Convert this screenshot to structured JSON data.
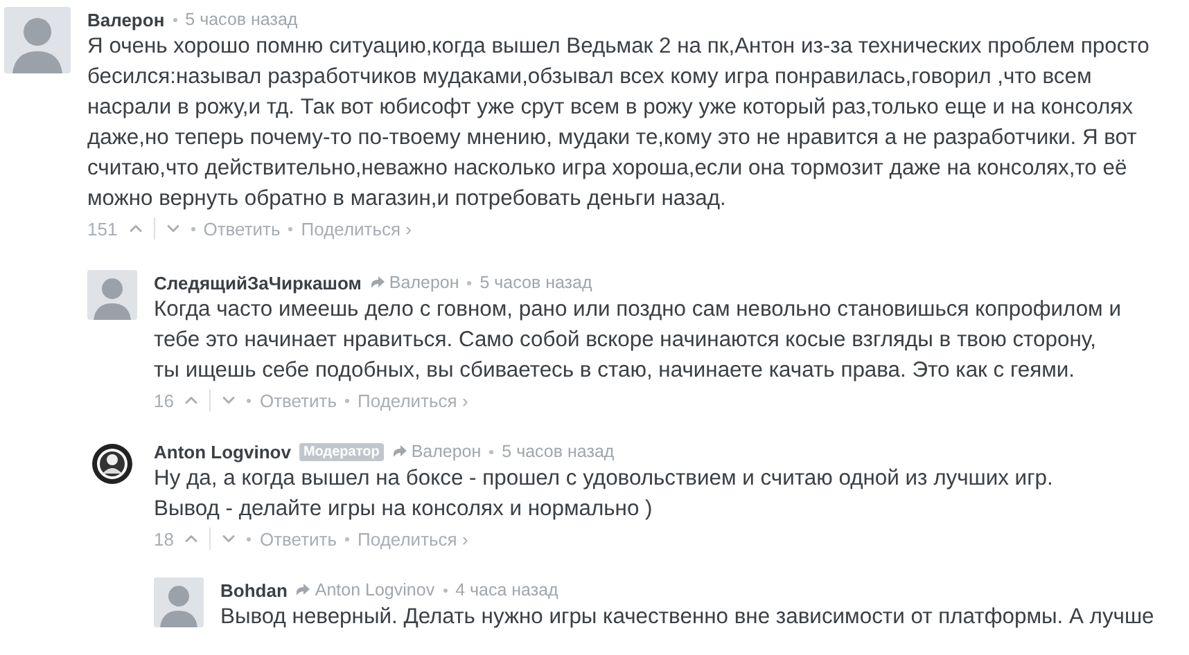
{
  "comments": [
    {
      "author": "Валерон",
      "avatar": {
        "kind": "placeholder"
      },
      "time": "5 часов назад",
      "text": "Я очень хорошо помню ситуацию,когда вышел Ведьмак 2 на пк,Антон из-за технических проблем просто бесился:называл разработчиков мудаками,обзывал всех кому игра понравилась,говорил ,что всем насрали в рожу,и тд. Так вот юбисофт уже срут всем в рожу уже который раз,только еще и на консолях даже,но теперь почему-то по-твоему мнению, мудаки те,кому это не нравится а не разработчики. Я вот считаю,что действительно,неважно насколько игра хороша,если она тормозит даже на консолях,то её можно вернуть обратно в магазин,и потребовать деньги назад.",
      "votes": "151",
      "actions": [
        "Ответить",
        "Поделиться ›"
      ],
      "children": [
        {
          "author": "СледящийЗаЧиркашом",
          "avatar": {
            "kind": "placeholder"
          },
          "reply_to": "Валерон",
          "time": "5 часов назад",
          "text": "Когда часто имеешь дело с говном, рано или поздно сам невольно становишься копрофилом и тебе это начинает нравиться. Само собой вскоре начинаются косые взгляды в твою сторону, ты ищешь себе подобных, вы сбиваетесь в стаю, начинаете качать права. Это как с геями.",
          "votes": "16",
          "actions": [
            "Ответить",
            "Поделиться ›"
          ]
        },
        {
          "author": "Anton Logvinov",
          "avatar": {
            "kind": "emblem"
          },
          "badge": "Модератор",
          "reply_to": "Валерон",
          "time": "5 часов назад",
          "text": "Ну да, а когда вышел на боксе - прошел с удовольствием и считаю одной из лучших игр. Вывод - делайте игры на консолях и нормально )",
          "votes": "18",
          "actions": [
            "Ответить",
            "Поделиться ›"
          ],
          "children": [
            {
              "author": "Bohdan",
              "avatar": {
                "kind": "placeholder"
              },
              "reply_to": "Anton Logvinov",
              "time": "4 часа назад",
              "text": "Вывод неверный. Делать нужно игры качественно вне зависимости от платформы. А лучше"
            }
          ]
        }
      ]
    }
  ]
}
